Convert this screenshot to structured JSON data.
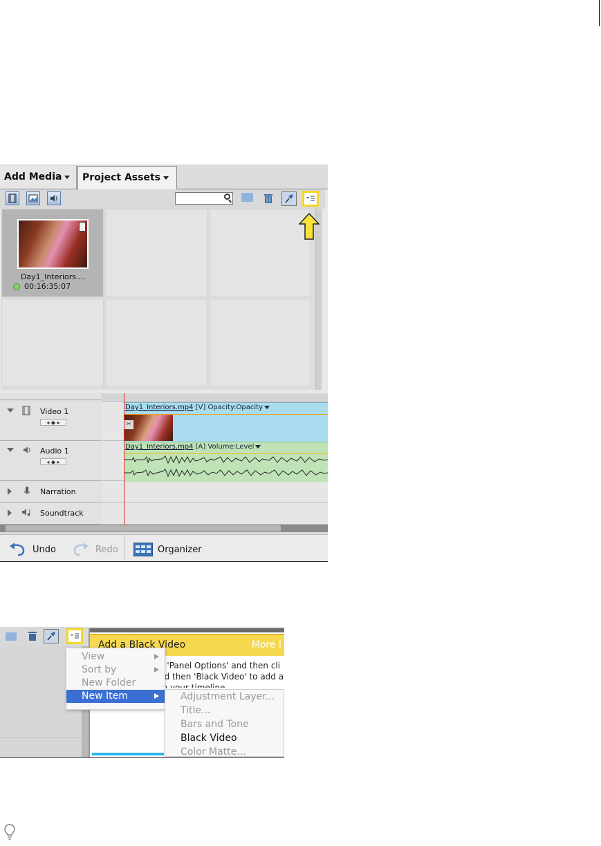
{
  "panel1": {
    "tabs": {
      "add_media": "Add Media",
      "project_assets": "Project Assets"
    },
    "toolbar": {
      "icons": [
        "video-filter-icon",
        "image-filter-icon",
        "audio-filter-icon",
        "search-icon",
        "new-folder-icon",
        "trash-icon",
        "pin-icon",
        "panel-options-icon"
      ],
      "search_value": "",
      "highlight_color": "#f5d72b"
    },
    "asset": {
      "name": "Day1_Interiors....",
      "duration": "00:16:35:07"
    },
    "tracks": {
      "video1": "Video 1",
      "audio1": "Audio 1",
      "narration": "Narration",
      "soundtrack": "Soundtrack"
    },
    "clips": {
      "video_name": "Day1_Interiors.mp4",
      "video_suffix": " [V] Opacity:Opacity",
      "audio_name": "Day1_Interiors.mp4",
      "audio_suffix": " [A] Volume:Level"
    },
    "bottom": {
      "undo": "Undo",
      "redo": "Redo",
      "organizer": "Organizer"
    }
  },
  "panel2": {
    "hint_title": "Add a Black Video",
    "hint_more": "More I",
    "hint_lines": [
      "n 'Panel Options' and then cli",
      "nd then 'Black Video' to add a",
      "to your timeline"
    ],
    "menu": [
      {
        "label": "View",
        "submenu": true,
        "enabled": false
      },
      {
        "label": "Sort by",
        "submenu": true,
        "enabled": false
      },
      {
        "label": "New Folder",
        "submenu": false,
        "enabled": false
      },
      {
        "label": "New Item",
        "submenu": true,
        "enabled": true,
        "active": true
      }
    ],
    "submenu": [
      {
        "label": "Adjustment Layer...",
        "enabled": false
      },
      {
        "label": "Title...",
        "enabled": false
      },
      {
        "label": "Bars and Tone",
        "enabled": false
      },
      {
        "label": "Black Video",
        "enabled": true
      },
      {
        "label": "Color Matte...",
        "enabled": false
      }
    ],
    "active_color": "#3b6fd4"
  },
  "tip_icon": "lightbulb-icon"
}
